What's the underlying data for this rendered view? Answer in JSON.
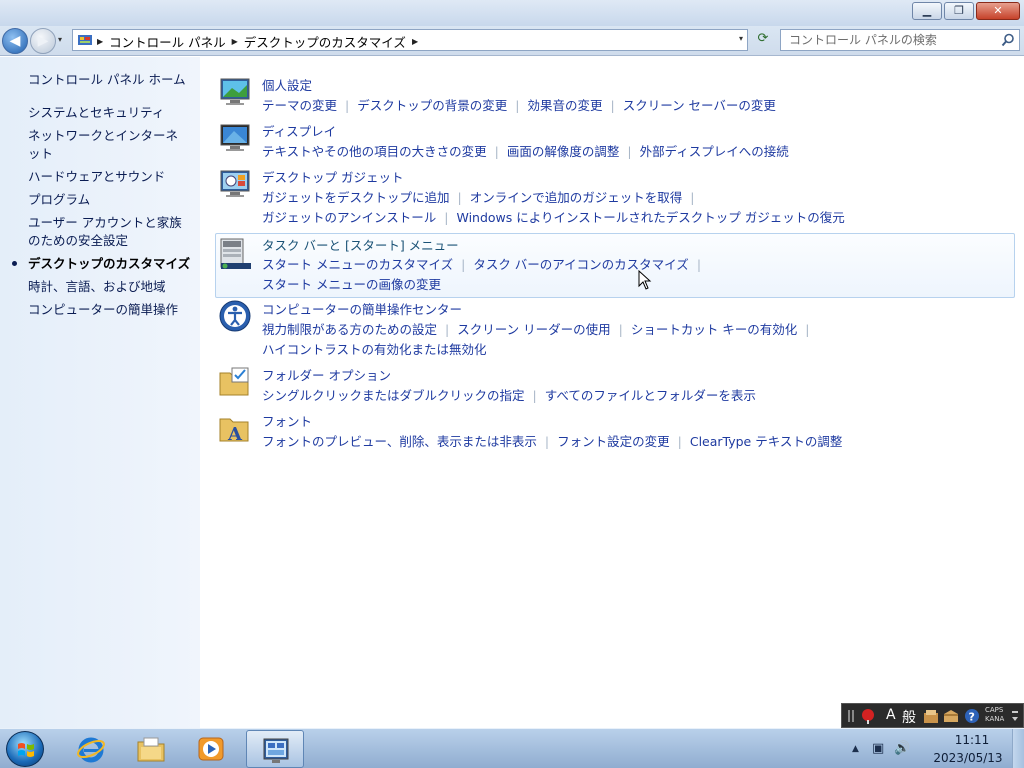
{
  "window": {
    "minimize_glyph": "▁",
    "maximize_glyph": "❐",
    "close_glyph": "✕"
  },
  "nav": {
    "back_glyph": "◀",
    "forward_glyph": "▶",
    "recent_glyph": "▾"
  },
  "address": {
    "crumbs": [
      "コントロール パネル",
      "デスクトップのカスタマイズ"
    ],
    "crumb_sep": "▶",
    "dropdown_glyph": "▾",
    "refresh_glyph": "⟳"
  },
  "search": {
    "placeholder": "コントロール パネルの検索"
  },
  "sidebar": {
    "home": "コントロール パネル ホーム",
    "items": [
      "システムとセキュリティ",
      "ネットワークとインターネット",
      "ハードウェアとサウンド",
      "プログラム",
      "ユーザー アカウントと家族のための安全設定",
      "デスクトップのカスタマイズ",
      "時計、言語、および地域",
      "コンピューターの簡単操作"
    ]
  },
  "categories": [
    {
      "title": "個人設定",
      "rows": [
        [
          "テーマの変更",
          "デスクトップの背景の変更",
          "効果音の変更",
          "スクリーン セーバーの変更"
        ]
      ]
    },
    {
      "title": "ディスプレイ",
      "rows": [
        [
          "テキストやその他の項目の大きさの変更",
          "画面の解像度の調整",
          "外部ディスプレイへの接続"
        ]
      ]
    },
    {
      "title": "デスクトップ ガジェット",
      "rows": [
        [
          "ガジェットをデスクトップに追加",
          "オンラインで追加のガジェットを取得"
        ],
        [
          "ガジェットのアンインストール",
          "Windows によりインストールされたデスクトップ ガジェットの復元"
        ]
      ]
    },
    {
      "title": "タスク バーと [スタート] メニュー",
      "rows": [
        [
          "スタート メニューのカスタマイズ",
          "タスク バーのアイコンのカスタマイズ"
        ],
        [
          "スタート メニューの画像の変更"
        ]
      ]
    },
    {
      "title": "コンピューターの簡単操作センター",
      "rows": [
        [
          "視力制限がある方のための設定",
          "スクリーン リーダーの使用",
          "ショートカット キーの有効化"
        ],
        [
          "ハイコントラストの有効化または無効化"
        ]
      ]
    },
    {
      "title": "フォルダー オプション",
      "rows": [
        [
          "シングルクリックまたはダブルクリックの指定",
          "すべてのファイルとフォルダーを表示"
        ]
      ]
    },
    {
      "title": "フォント",
      "rows": [
        [
          "フォントのプレビュー、削除、表示または非表示",
          "フォント設定の変更",
          "ClearType テキストの調整"
        ]
      ]
    }
  ],
  "langbar": {
    "ime_mode": "A",
    "ime_kanji": "般",
    "caps": "CAPS",
    "kana": "KANA",
    "help_glyph": "?"
  },
  "tray": {
    "expand_glyph": "▲",
    "network_glyph": "▣",
    "volume_glyph": "🔊",
    "time": "11:11",
    "date": "2023/05/13"
  }
}
